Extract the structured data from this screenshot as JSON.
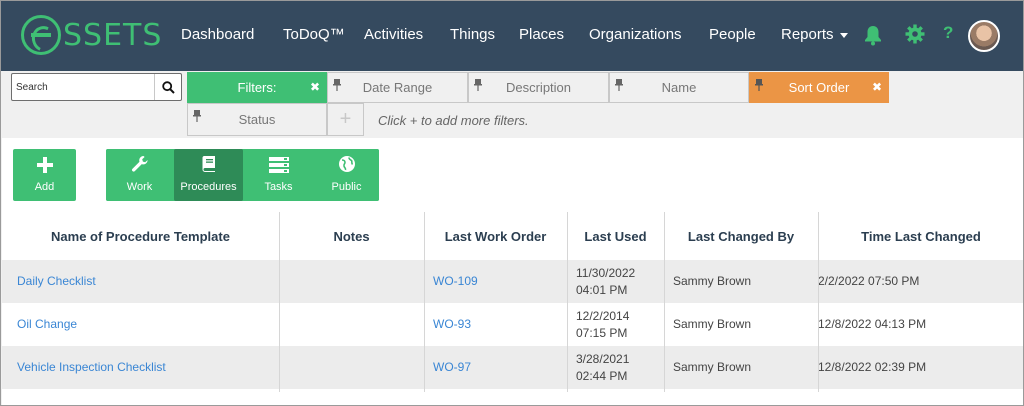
{
  "brand": {
    "logo_text": "SSETS"
  },
  "nav": {
    "items": [
      "Dashboard",
      "ToDoQ™",
      "Activities",
      "Things",
      "Places",
      "Organizations",
      "People"
    ],
    "reports": "Reports",
    "help": "?"
  },
  "search": {
    "placeholder": "Search",
    "value": ""
  },
  "filters": {
    "header": "Filters:",
    "date_range": "Date Range",
    "description": "Description",
    "name": "Name",
    "sort_order": "Sort Order",
    "status": "Status",
    "add_symbol": "+",
    "hint": "Click + to add more filters."
  },
  "actions": {
    "add": "Add",
    "work": "Work",
    "procedures": "Procedures",
    "tasks": "Tasks",
    "public": "Public"
  },
  "table": {
    "columns": [
      "Name of Procedure Template",
      "Notes",
      "Last Work Order",
      "Last Used",
      "Last Changed By",
      "Time Last Changed"
    ],
    "rows": [
      {
        "name": "Daily Checklist",
        "notes": "",
        "work_order": "WO-109",
        "last_used_date": "11/30/2022",
        "last_used_time": "04:01 PM",
        "changed_by": "Sammy Brown",
        "time_changed": "2/2/2022 07:50 PM"
      },
      {
        "name": "Oil Change",
        "notes": "",
        "work_order": "WO-93",
        "last_used_date": "12/2/2014",
        "last_used_time": "07:15 PM",
        "changed_by": "Sammy Brown",
        "time_changed": "12/8/2022 04:13 PM"
      },
      {
        "name": "Vehicle Inspection Checklist",
        "notes": "",
        "work_order": "WO-97",
        "last_used_date": "3/28/2021",
        "last_used_time": "02:44 PM",
        "changed_by": "Sammy Brown",
        "time_changed": "12/8/2022 02:39 PM"
      }
    ]
  },
  "colors": {
    "nav_bg": "#354a5f",
    "accent_green": "#3fbf74",
    "active_green": "#2e8b57",
    "sort_orange": "#eb9545",
    "link_blue": "#3a86d4"
  }
}
